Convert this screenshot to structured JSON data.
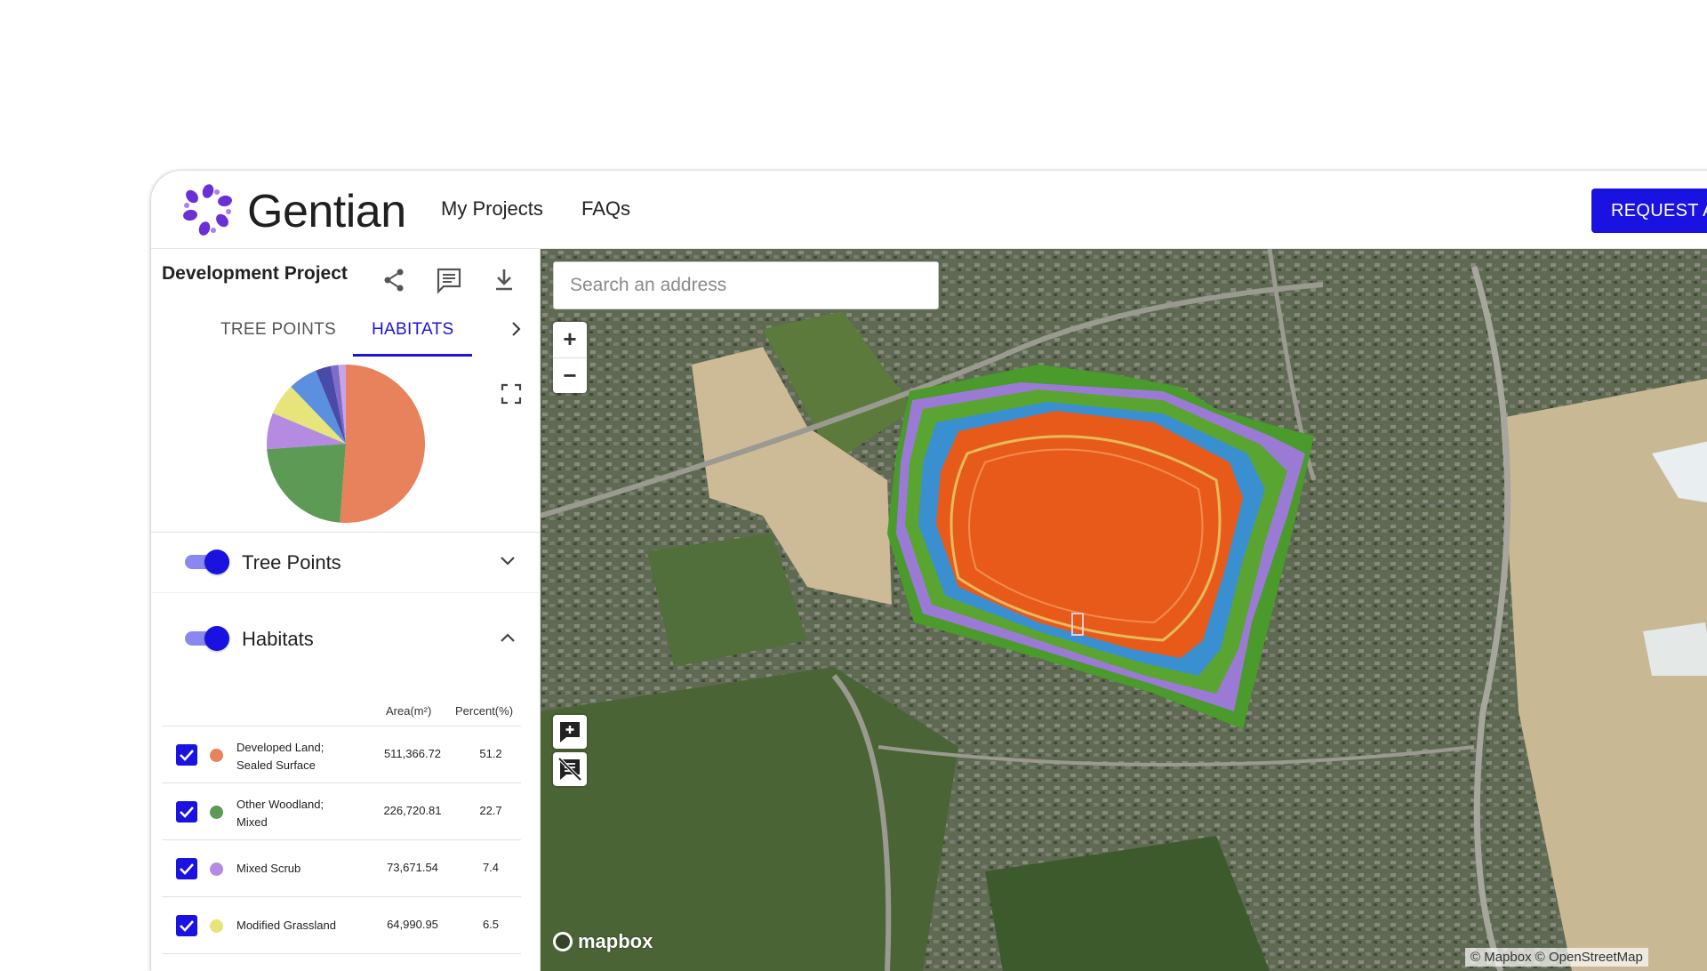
{
  "header": {
    "brand": "Gentian",
    "nav": [
      "My Projects",
      "FAQs"
    ],
    "request_button": "REQUEST A"
  },
  "sidebar": {
    "project_title": "Development Project",
    "icons": [
      "share-icon",
      "comment-list-icon",
      "download-icon"
    ],
    "tabs": [
      {
        "label": "TREE POINTS",
        "active": false
      },
      {
        "label": "HABITATS",
        "active": true
      }
    ],
    "layers": [
      {
        "label": "Tree Points",
        "enabled": true,
        "expanded": false
      },
      {
        "label": "Habitats",
        "enabled": true,
        "expanded": true
      }
    ],
    "table": {
      "headers": [
        "Area(m²)",
        "Percent(%)"
      ],
      "rows": [
        {
          "label": "Developed Land; Sealed Surface",
          "area": "511,366.72",
          "percent": "51.2",
          "color": "#e8825c",
          "checked": true
        },
        {
          "label": "Other Woodland; Mixed",
          "area": "226,720.81",
          "percent": "22.7",
          "color": "#5c9a55",
          "checked": true
        },
        {
          "label": "Mixed Scrub",
          "area": "73,671.54",
          "percent": "7.4",
          "color": "#b48be0",
          "checked": true
        },
        {
          "label": "Modified Grassland",
          "area": "64,990.95",
          "percent": "6.5",
          "color": "#e6e47a",
          "checked": true
        }
      ]
    }
  },
  "chart_data": {
    "type": "pie",
    "slices": [
      {
        "label": "Developed Land; Sealed Surface",
        "value": 51.2,
        "color": "#e8825c"
      },
      {
        "label": "Other Woodland; Mixed",
        "value": 22.7,
        "color": "#5c9a55"
      },
      {
        "label": "Mixed Scrub",
        "value": 7.4,
        "color": "#b48be0"
      },
      {
        "label": "Modified Grassland",
        "value": 6.5,
        "color": "#e6e47a"
      },
      {
        "value": 6.0,
        "color": "#5b8fe0"
      },
      {
        "value": 3.1,
        "color": "#4a4aa8"
      },
      {
        "value": 1.6,
        "color": "#7e6cc8"
      },
      {
        "value": 1.5,
        "color": "#c9a3e6"
      }
    ]
  },
  "map": {
    "search_placeholder": "Search an address",
    "zoom_in": "+",
    "zoom_out": "−",
    "logo": "mapbox",
    "attribution": "© Mapbox © OpenStreetMap"
  },
  "colors": {
    "accent": "#1a12e0",
    "toggle_track": "#8b87f0"
  }
}
